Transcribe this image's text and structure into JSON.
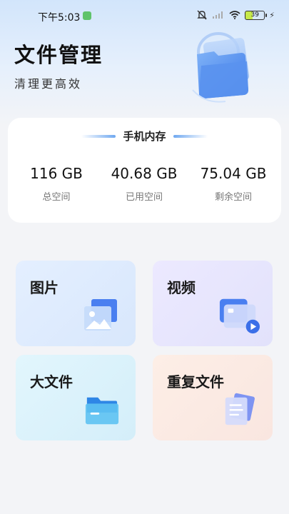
{
  "status_bar": {
    "time": "下午5:03",
    "battery": "39",
    "icons": [
      "notification-app-icon",
      "mute-icon",
      "signal-icon",
      "wifi-icon",
      "battery-icon",
      "charging-icon"
    ]
  },
  "header": {
    "title": "文件管理",
    "subtitle": "清理更高效",
    "hero_icon": "folder-illustration-icon"
  },
  "storage": {
    "title": "手机内存",
    "stats": [
      {
        "value": "116 GB",
        "label": "总空间"
      },
      {
        "value": "40.68 GB",
        "label": "已用空间"
      },
      {
        "value": "75.04 GB",
        "label": "剩余空间"
      }
    ]
  },
  "categories": [
    {
      "label": "图片",
      "icon": "image-icon"
    },
    {
      "label": "视频",
      "icon": "video-icon"
    },
    {
      "label": "大文件",
      "icon": "folder-icon"
    },
    {
      "label": "重复文件",
      "icon": "duplicate-files-icon"
    }
  ],
  "colors": {
    "header_gradient_top": "#d2e5fb",
    "background": "#f3f4f7",
    "accent_blue": "#4a8af0",
    "images_tile": "#dce9fc",
    "video_tile": "#e6e4fc",
    "large_tile": "#daf1fb",
    "dup_tile": "#fbe9e2"
  }
}
